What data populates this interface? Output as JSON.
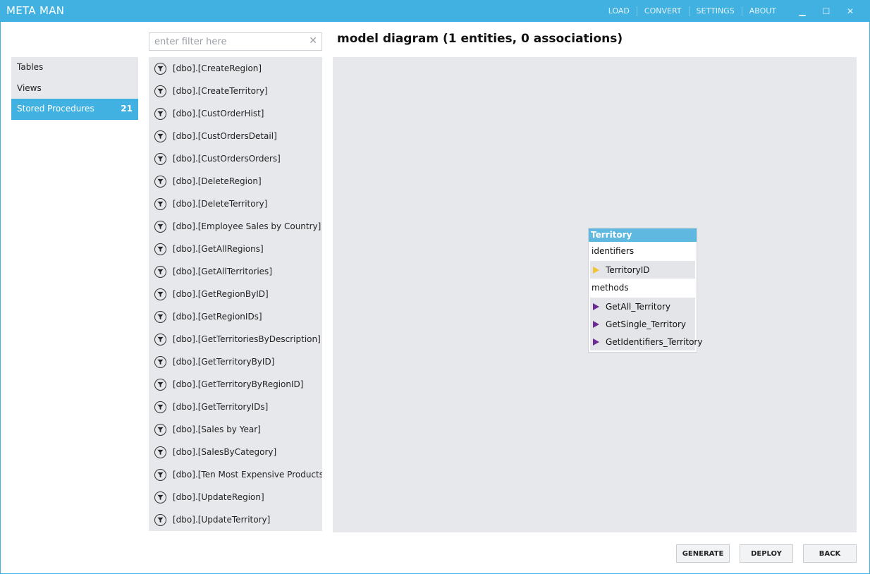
{
  "app": {
    "title": "META MAN"
  },
  "menu": {
    "load": "LOAD",
    "convert": "CONVERT",
    "settings": "SETTINGS",
    "about": "ABOUT"
  },
  "window_controls": {
    "minimize": "▁",
    "maximize": "☐",
    "close": "✕"
  },
  "filter": {
    "placeholder": "enter filter here",
    "value": "",
    "clear_glyph": "✕"
  },
  "nav": {
    "items": [
      {
        "label": "Tables",
        "count": ""
      },
      {
        "label": "Views",
        "count": ""
      },
      {
        "label": "Stored Procedures",
        "count": "21"
      }
    ],
    "active": "Stored Procedures"
  },
  "procedures": [
    "[dbo].[CreateRegion]",
    "[dbo].[CreateTerritory]",
    "[dbo].[CustOrderHist]",
    "[dbo].[CustOrdersDetail]",
    "[dbo].[CustOrdersOrders]",
    "[dbo].[DeleteRegion]",
    "[dbo].[DeleteTerritory]",
    "[dbo].[Employee Sales by Country]",
    "[dbo].[GetAllRegions]",
    "[dbo].[GetAllTerritories]",
    "[dbo].[GetRegionByID]",
    "[dbo].[GetRegionIDs]",
    "[dbo].[GetTerritoriesByDescription]",
    "[dbo].[GetTerritoryByID]",
    "[dbo].[GetTerritoryByRegionID]",
    "[dbo].[GetTerritoryIDs]",
    "[dbo].[Sales by Year]",
    "[dbo].[SalesByCategory]",
    "[dbo].[Ten Most Expensive Products]",
    "[dbo].[UpdateRegion]",
    "[dbo].[UpdateTerritory]"
  ],
  "diagram": {
    "title": "model diagram  (1 entities, 0 associations)",
    "entity": {
      "name": "Territory",
      "identifiers_label": "identifiers",
      "identifiers": [
        "TerritoryID"
      ],
      "methods_label": "methods",
      "methods": [
        "GetAll_Territory",
        "GetSingle_Territory",
        "GetIdentifiers_Territory"
      ]
    }
  },
  "buttons": {
    "generate": "GENERATE",
    "deploy": "DEPLOY",
    "back": "BACK"
  },
  "colors": {
    "accent": "#41b1e1",
    "panel": "#e7e8eb",
    "entity_header": "#5fb8e0",
    "key_icon": "#f1c232",
    "method_icon": "#6c2b93"
  }
}
